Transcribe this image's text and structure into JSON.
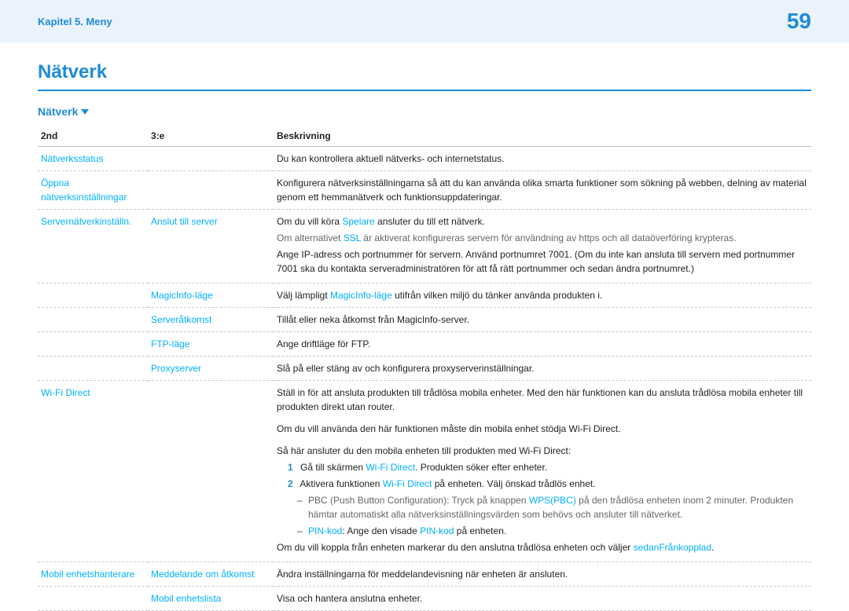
{
  "header": {
    "breadcrumb": "Kapitel 5. Meny",
    "page_number": "59"
  },
  "title": "Nätverk",
  "section": {
    "heading": "Nätverk"
  },
  "columns": {
    "c1": "2nd",
    "c2": "3:e",
    "c3": "Beskrivning"
  },
  "rows": {
    "r1": {
      "a": "Nätverksstatus",
      "b": "",
      "desc": "Du kan kontrollera aktuell nätverks- och internetstatus."
    },
    "r2": {
      "a1": "Öppna",
      "a2": "nätverksinställningar",
      "desc": "Konfigurera nätverksinställningarna så att du kan använda olika smarta funktioner som sökning på webben, delning av material genom ett hemmanätverk och funktionsuppdateringar."
    },
    "r3": {
      "a": "Servernätverkinställn.",
      "b": "Anslut till server",
      "pre": "Om du vill köra ",
      "link": "Spelare",
      "post": " ansluter du till ett nätverk.",
      "g_pre": "Om alternativet ",
      "g_link": "SSL",
      "g_post": " är aktiverat konfigureras servern för användning av https och all dataöverföring krypteras.",
      "ip": "Ange IP-adress och portnummer för servern. Använd portnumret 7001. (Om du inte kan ansluta till servern med portnummer 7001 ska du kontakta serveradministratören för att få rätt portnummer och sedan ändra portnumret.)"
    },
    "r4": {
      "b": "MagicInfo-läge",
      "pre": "Välj lämpligt ",
      "link": "MagicInfo-läge",
      "post": " utifrån vilken miljö du tänker använda produkten i."
    },
    "r5": {
      "b": "Serveråtkomst",
      "desc": "Tillåt eller neka åtkomst från MagicInfo-server."
    },
    "r6": {
      "b": "FTP-läge",
      "desc": "Ange driftläge för FTP."
    },
    "r7": {
      "b": "Proxyserver",
      "desc": "Slå på eller stäng av och konfigurera proxyserverinställningar."
    },
    "r8": {
      "a": "Wi-Fi Direct",
      "p1": "Ställ in för att ansluta produkten till trådlösa mobila enheter. Med den här funktionen kan du ansluta trådlösa mobila enheter till produkten direkt utan router.",
      "p2": "Om du vill använda den här funktionen måste din mobila enhet stödja Wi-Fi Direct.",
      "p3": "Så här ansluter du den mobila enheten till produkten med Wi-Fi Direct:",
      "step1_pre": "Gå till skärmen ",
      "step1_link": "Wi-Fi Direct",
      "step1_post": ". Produkten söker efter enheter.",
      "step2_pre": "Aktivera funktionen ",
      "step2_link": "Wi-Fi Direct",
      "step2_post": " på enheten. Välj önskad trådlös enhet.",
      "pbc_pre": "PBC (Push Button Configuration): Tryck på knappen ",
      "pbc_link": "WPS(PBC)",
      "pbc_post": " på den trådlösa enheten inom 2 minuter. Produkten hämtar automatiskt alla nätverksinställningsvärden som behövs och ansluter till nätverket.",
      "pin_label": "PIN-kod",
      "pin_mid": ": Ange den visade ",
      "pin_link": "PIN-kod",
      "pin_post": " på enheten.",
      "disc_pre": "Om du vill koppla från enheten markerar du den anslutna trådlösa enheten och väljer ",
      "disc_link1": "sedan",
      "disc_link2": "Frånkopplad",
      "disc_end": "."
    },
    "r9": {
      "a": "Mobil enhetshanterare",
      "b": "Meddelande om åtkomst",
      "desc": "Ändra inställningarna för meddelandevisning när enheten är ansluten."
    },
    "r10": {
      "b": "Mobil enhetslista",
      "desc": "Visa och hantera anslutna enheter."
    }
  }
}
